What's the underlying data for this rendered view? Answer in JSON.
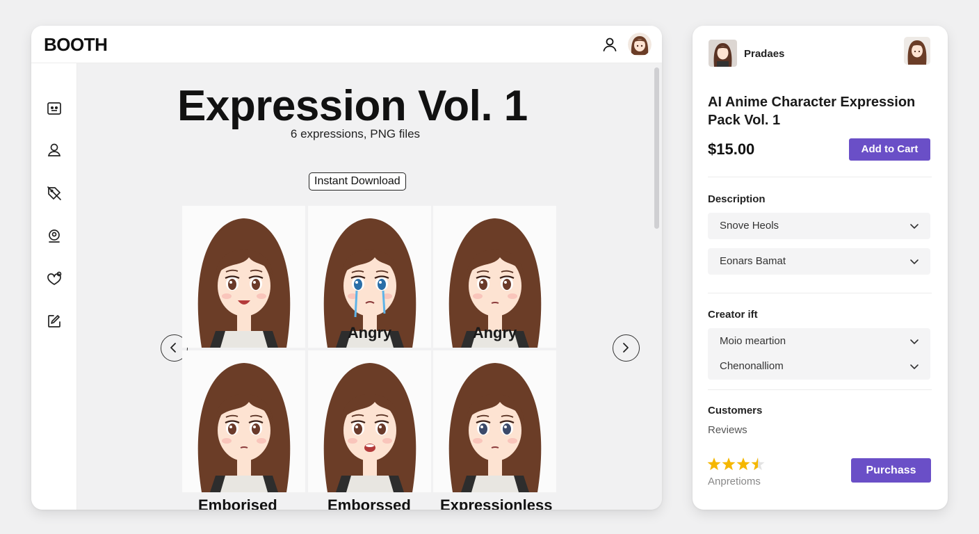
{
  "app": {
    "logo": "BOOTH",
    "icons": {
      "top_user": "user-outline-icon",
      "sidebar": [
        "shop-icon",
        "person-icon",
        "tag-off-icon",
        "user-circle-icon",
        "heart-chat-icon",
        "edit-square-icon"
      ],
      "nav_prev": "chevron-left-icon",
      "nav_next": "chevron-right-icon",
      "accordion": "chevron-down-icon",
      "stars": "star-icon"
    }
  },
  "product_preview": {
    "title": "Expression Vol. 1",
    "subtitle": "6 expressions, PNG files",
    "badge": "Instant Download",
    "tiles": [
      {
        "expression": "smile",
        "caption": ""
      },
      {
        "expression": "crying",
        "caption": "Angry"
      },
      {
        "expression": "worried",
        "caption": "Angry"
      },
      {
        "expression": "neutral",
        "caption": ""
      },
      {
        "expression": "shocked",
        "caption": ""
      },
      {
        "expression": "blank",
        "caption": ""
      }
    ],
    "row_labels": [
      "Emborised",
      "Emborssed",
      "Expressionless"
    ]
  },
  "sidebar_panel": {
    "seller_name": "Pradaes",
    "product_title": "AI Anime Character Expression Pack Vol. 1",
    "price": "$15.00",
    "add_to_cart_label": "Add to Cart",
    "description": {
      "heading": "Description",
      "items": [
        "Snove Heols",
        "Eonars Bamat"
      ]
    },
    "creator": {
      "heading": "Creator ift",
      "items": [
        "Moio meartion",
        "Chenonalliom"
      ]
    },
    "customers": {
      "heading": "Customers",
      "reviews_label": "Reviews",
      "rating_stars": 3.5,
      "rating_max": 5,
      "rating_sub": "Anpretioms",
      "purchase_label": "Purchass"
    }
  },
  "colors": {
    "accent": "#6a4fc7",
    "star": "#f5b700",
    "hair": "#6b3d27",
    "skin": "#fde3d2"
  }
}
